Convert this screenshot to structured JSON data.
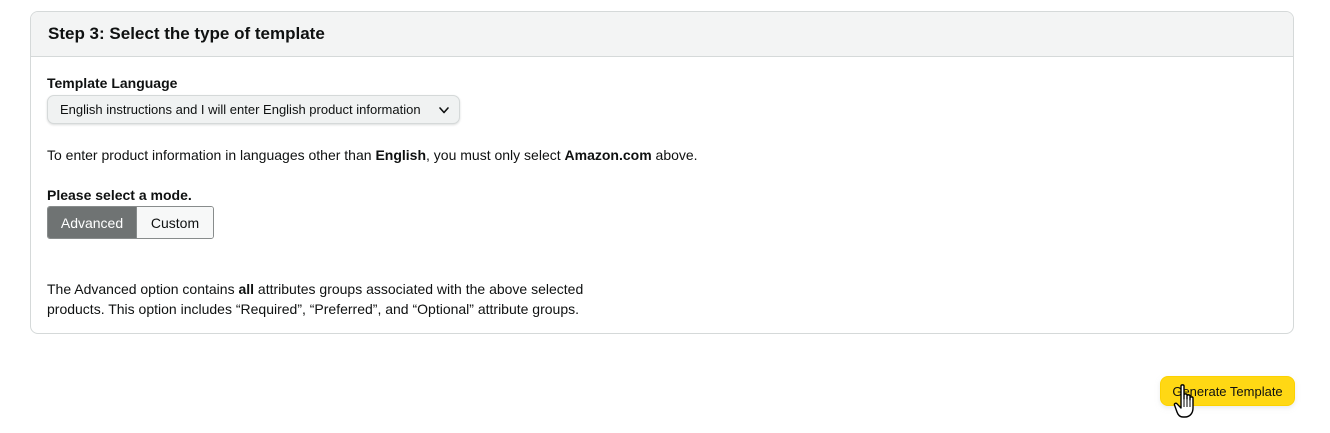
{
  "section": {
    "title": "Step 3: Select the type of template"
  },
  "template_language": {
    "label": "Template Language",
    "selected": "English instructions and I will enter English product information"
  },
  "info": {
    "prefix": "To enter product information in languages other than ",
    "language": "English",
    "middle": ", you must only select ",
    "marketplace": "Amazon.com",
    "suffix": " above."
  },
  "mode": {
    "label": "Please select a mode.",
    "options": [
      "Advanced",
      "Custom"
    ],
    "selected": "Advanced"
  },
  "description": {
    "prefix": "The Advanced option contains ",
    "emphasis": "all",
    "suffix": " attributes groups associated with the above selected products. This option includes “Required”, “Preferred”, and “Optional” attribute groups."
  },
  "generate_button": {
    "label": "Generate Template"
  },
  "icons": {
    "dropdown": "chevron-down-icon",
    "cursor": "hand-pointer-cursor-icon"
  },
  "colors": {
    "primary_button": "#ffd814",
    "segment_active": "#6f7373",
    "header_bg": "#f3f4f4"
  }
}
